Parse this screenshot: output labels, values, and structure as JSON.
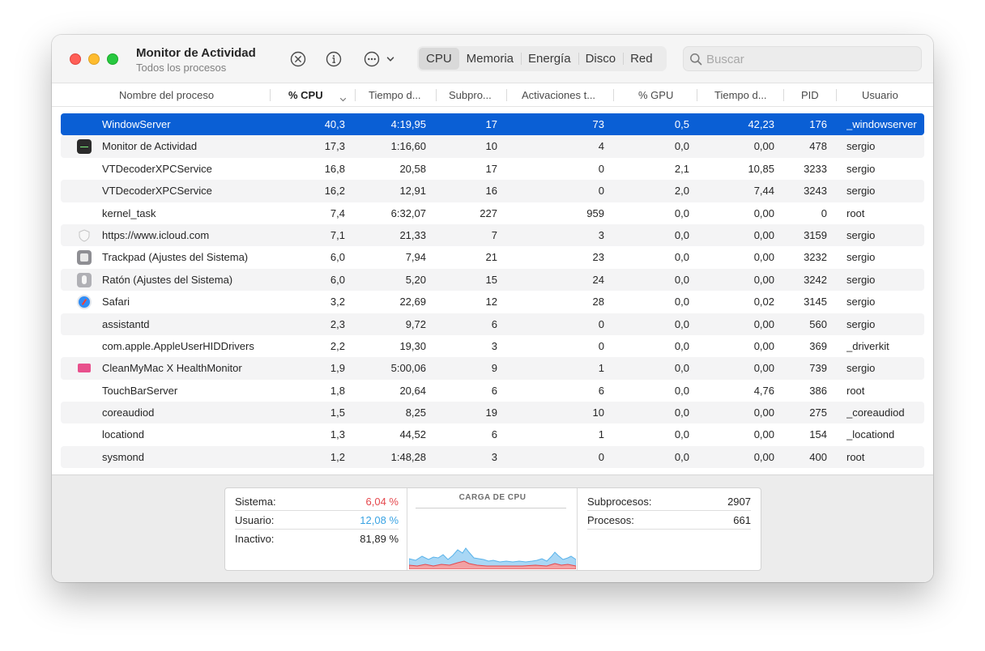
{
  "window": {
    "title": "Monitor de Actividad",
    "subtitle": "Todos los procesos"
  },
  "toolbar": {
    "stop_icon": "xmark-circle-icon",
    "info_icon": "info-circle-icon",
    "more_icon": "ellipsis-circle-icon",
    "tabs": [
      "CPU",
      "Memoria",
      "Energía",
      "Disco",
      "Red"
    ],
    "active_tab": "CPU",
    "search_placeholder": "Buscar"
  },
  "columns": {
    "name": "Nombre del proceso",
    "cpu": "% CPU",
    "cpu_time": "Tiempo d...",
    "threads": "Subpro...",
    "wakes": "Activaciones t...",
    "gpu": "% GPU",
    "gpu_time": "Tiempo d...",
    "pid": "PID",
    "user": "Usuario"
  },
  "processes": [
    {
      "icon": "",
      "name": "WindowServer",
      "cpu": "40,3",
      "time": "4:19,95",
      "threads": "17",
      "wakes": "73",
      "gpu": "0,5",
      "gpu_time": "42,23",
      "pid": "176",
      "user": "_windowserver"
    },
    {
      "icon": "activity-monitor-icon",
      "name": "Monitor de Actividad",
      "cpu": "17,3",
      "time": "1:16,60",
      "threads": "10",
      "wakes": "4",
      "gpu": "0,0",
      "gpu_time": "0,00",
      "pid": "478",
      "user": "sergio"
    },
    {
      "icon": "",
      "name": "VTDecoderXPCService",
      "cpu": "16,8",
      "time": "20,58",
      "threads": "17",
      "wakes": "0",
      "gpu": "2,1",
      "gpu_time": "10,85",
      "pid": "3233",
      "user": "sergio"
    },
    {
      "icon": "",
      "name": "VTDecoderXPCService",
      "cpu": "16,2",
      "time": "12,91",
      "threads": "16",
      "wakes": "0",
      "gpu": "2,0",
      "gpu_time": "7,44",
      "pid": "3243",
      "user": "sergio"
    },
    {
      "icon": "",
      "name": "kernel_task",
      "cpu": "7,4",
      "time": "6:32,07",
      "threads": "227",
      "wakes": "959",
      "gpu": "0,0",
      "gpu_time": "0,00",
      "pid": "0",
      "user": "root"
    },
    {
      "icon": "shield-icon",
      "name": "https://www.icloud.com",
      "cpu": "7,1",
      "time": "21,33",
      "threads": "7",
      "wakes": "3",
      "gpu": "0,0",
      "gpu_time": "0,00",
      "pid": "3159",
      "user": "sergio"
    },
    {
      "icon": "trackpad-settings-icon",
      "name": "Trackpad (Ajustes del Sistema)",
      "cpu": "6,0",
      "time": "7,94",
      "threads": "21",
      "wakes": "23",
      "gpu": "0,0",
      "gpu_time": "0,00",
      "pid": "3232",
      "user": "sergio"
    },
    {
      "icon": "mouse-settings-icon",
      "name": "Ratón (Ajustes del Sistema)",
      "cpu": "6,0",
      "time": "5,20",
      "threads": "15",
      "wakes": "24",
      "gpu": "0,0",
      "gpu_time": "0,00",
      "pid": "3242",
      "user": "sergio"
    },
    {
      "icon": "safari-icon",
      "name": "Safari",
      "cpu": "3,2",
      "time": "22,69",
      "threads": "12",
      "wakes": "28",
      "gpu": "0,0",
      "gpu_time": "0,02",
      "pid": "3145",
      "user": "sergio"
    },
    {
      "icon": "",
      "name": "assistantd",
      "cpu": "2,3",
      "time": "9,72",
      "threads": "6",
      "wakes": "0",
      "gpu": "0,0",
      "gpu_time": "0,00",
      "pid": "560",
      "user": "sergio"
    },
    {
      "icon": "",
      "name": "com.apple.AppleUserHIDDrivers",
      "cpu": "2,2",
      "time": "19,30",
      "threads": "3",
      "wakes": "0",
      "gpu": "0,0",
      "gpu_time": "0,00",
      "pid": "369",
      "user": "_driverkit"
    },
    {
      "icon": "cleanmymac-icon",
      "name": "CleanMyMac X HealthMonitor",
      "cpu": "1,9",
      "time": "5:00,06",
      "threads": "9",
      "wakes": "1",
      "gpu": "0,0",
      "gpu_time": "0,00",
      "pid": "739",
      "user": "sergio"
    },
    {
      "icon": "",
      "name": "TouchBarServer",
      "cpu": "1,8",
      "time": "20,64",
      "threads": "6",
      "wakes": "6",
      "gpu": "0,0",
      "gpu_time": "4,76",
      "pid": "386",
      "user": "root"
    },
    {
      "icon": "",
      "name": "coreaudiod",
      "cpu": "1,5",
      "time": "8,25",
      "threads": "19",
      "wakes": "10",
      "gpu": "0,0",
      "gpu_time": "0,00",
      "pid": "275",
      "user": "_coreaudiod"
    },
    {
      "icon": "",
      "name": "locationd",
      "cpu": "1,3",
      "time": "44,52",
      "threads": "6",
      "wakes": "1",
      "gpu": "0,0",
      "gpu_time": "0,00",
      "pid": "154",
      "user": "_locationd"
    },
    {
      "icon": "",
      "name": "sysmond",
      "cpu": "1,2",
      "time": "1:48,28",
      "threads": "3",
      "wakes": "0",
      "gpu": "0,0",
      "gpu_time": "0,00",
      "pid": "400",
      "user": "root"
    }
  ],
  "selected_row": 0,
  "stats": {
    "system_label": "Sistema:",
    "system_value": "6,04 %",
    "user_label": "Usuario:",
    "user_value": "12,08 %",
    "idle_label": "Inactivo:",
    "idle_value": "81,89 %",
    "chart_title": "CARGA DE CPU",
    "threads_label": "Subprocesos:",
    "threads_value": "2907",
    "processes_label": "Procesos:",
    "processes_value": "661"
  },
  "colors": {
    "selection": "#0a5fd5",
    "system_red": "#e5484d",
    "user_blue": "#3aa3e3"
  }
}
